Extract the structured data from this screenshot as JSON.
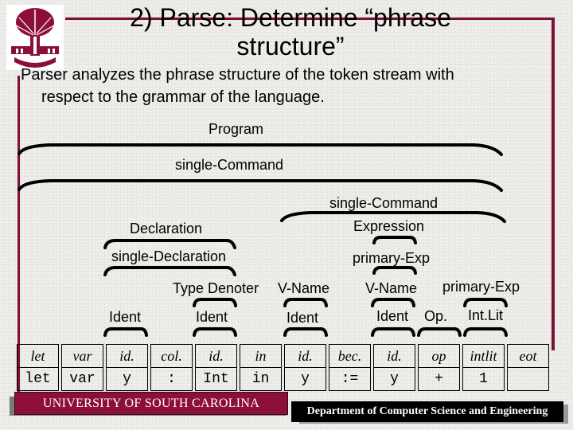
{
  "slide": {
    "title": "2) Parse: Determine “phrase structure”",
    "body_line1": "Parser analyzes the phrase structure of the token stream with",
    "body_line2": "respect to the grammar of the language."
  },
  "tree": {
    "program": "Program",
    "single_command_top": "single-Command",
    "single_command_inner": "single-Command",
    "declaration": "Declaration",
    "single_declaration": "single-Declaration",
    "expression": "Expression",
    "primary_exp_1": "primary-Exp",
    "type_denoter": "Type Denoter",
    "v_name_1": "V-Name",
    "v_name_2": "V-Name",
    "primary_exp_2": "primary-Exp",
    "ident_1": "Ident",
    "ident_2": "Ident",
    "ident_3": "Ident",
    "ident_4": "Ident",
    "op": "Op.",
    "int_lit": "Int.Lit"
  },
  "tokens": {
    "kinds": [
      "let",
      "var",
      "id.",
      "col.",
      "id.",
      "in",
      "id.",
      "bec.",
      "id.",
      "op",
      "intlit",
      "eot"
    ],
    "spellings": [
      "let",
      "var",
      "y",
      ":",
      "Int",
      "in",
      "y",
      ":=",
      "y",
      "+",
      "1",
      ""
    ]
  },
  "footer": {
    "university": "UNIVERSITY OF SOUTH CAROLINA",
    "department": "Department of Computer Science and Engineering"
  },
  "colors": {
    "accent": "#7a1038",
    "banner": "#8c0f3a"
  }
}
